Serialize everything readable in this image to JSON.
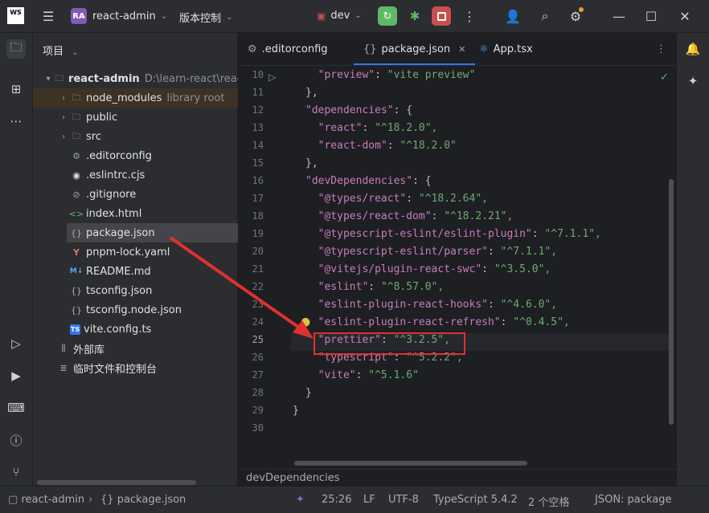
{
  "titlebar": {
    "logo_text": "WS",
    "project_badge": "RA",
    "project_name": "react-admin",
    "vcs_label": "版本控制",
    "branch": "dev"
  },
  "project_panel": {
    "title": "项目",
    "root_name": "react-admin",
    "root_path": "D:\\learn-react\\react",
    "items": [
      {
        "label": "node_modules",
        "note": "library root"
      },
      {
        "label": "public"
      },
      {
        "label": "src"
      },
      {
        "label": ".editorconfig"
      },
      {
        "label": ".eslintrc.cjs"
      },
      {
        "label": ".gitignore"
      },
      {
        "label": "index.html"
      },
      {
        "label": "package.json"
      },
      {
        "label": "pnpm-lock.yaml"
      },
      {
        "label": "README.md"
      },
      {
        "label": "tsconfig.json"
      },
      {
        "label": "tsconfig.node.json"
      },
      {
        "label": "vite.config.ts"
      }
    ],
    "external_libs": "外部库",
    "scratches": "临时文件和控制台"
  },
  "editor": {
    "tabs": [
      {
        "label": ".editorconfig"
      },
      {
        "label": "package.json"
      },
      {
        "label": "App.tsx"
      }
    ],
    "line_numbers": [
      "10",
      "11",
      "12",
      "13",
      "14",
      "15",
      "16",
      "17",
      "18",
      "19",
      "20",
      "21",
      "22",
      "23",
      "24",
      "25",
      "26",
      "27",
      "28",
      "29",
      "30"
    ],
    "lines": [
      [
        "  ",
        "\"preview\"",
        ": ",
        "\"vite preview\""
      ],
      [
        "},",
        "",
        "",
        ""
      ],
      [
        "",
        "\"dependencies\"",
        ": {",
        ""
      ],
      [
        "  ",
        "\"react\"",
        ": ",
        "\"^18.2.0\","
      ],
      [
        "  ",
        "\"react-dom\"",
        ": ",
        "\"^18.2.0\""
      ],
      [
        "},",
        "",
        "",
        ""
      ],
      [
        "",
        "\"devDependencies\"",
        ": {",
        ""
      ],
      [
        "  ",
        "\"@types/react\"",
        ": ",
        "\"^18.2.64\","
      ],
      [
        "  ",
        "\"@types/react-dom\"",
        ": ",
        "\"^18.2.21\","
      ],
      [
        "  ",
        "\"@typescript-eslint/eslint-plugin\"",
        ": ",
        "\"^7.1.1\","
      ],
      [
        "  ",
        "\"@typescript-eslint/parser\"",
        ": ",
        "\"^7.1.1\","
      ],
      [
        "  ",
        "\"@vitejs/plugin-react-swc\"",
        ": ",
        "\"^3.5.0\","
      ],
      [
        "  ",
        "\"eslint\"",
        ": ",
        "\"^8.57.0\","
      ],
      [
        "  ",
        "\"eslint-plugin-react-hooks\"",
        ": ",
        "\"^4.6.0\","
      ],
      [
        "  ",
        "\"eslint-plugin-react-refresh\"",
        ": ",
        "\"^0.4.5\","
      ],
      [
        "  ",
        "\"prettier\"",
        ": ",
        "\"^3.2.5\","
      ],
      [
        "  ",
        "\"typescript\"",
        ": ",
        "\"^5.2.2\","
      ],
      [
        "  ",
        "\"vite\"",
        ": ",
        "\"^5.1.6\""
      ],
      [
        "}",
        "",
        "",
        ""
      ],
      [
        "}",
        "",
        "",
        ""
      ],
      [
        "",
        "",
        "",
        ""
      ]
    ],
    "breadcrumb": "devDependencies"
  },
  "statusbar": {
    "project": "react-admin",
    "file": "package.json",
    "position": "25:26",
    "line_sep": "LF",
    "encoding": "UTF-8",
    "language": "TypeScript 5.4.2",
    "indent": "2 个空格",
    "schema": "JSON: package"
  },
  "colors": {
    "accent": "#3574f0",
    "annotation_red": "#e03030",
    "run_green": "#5fb865",
    "stop_red": "#c94f4f"
  }
}
